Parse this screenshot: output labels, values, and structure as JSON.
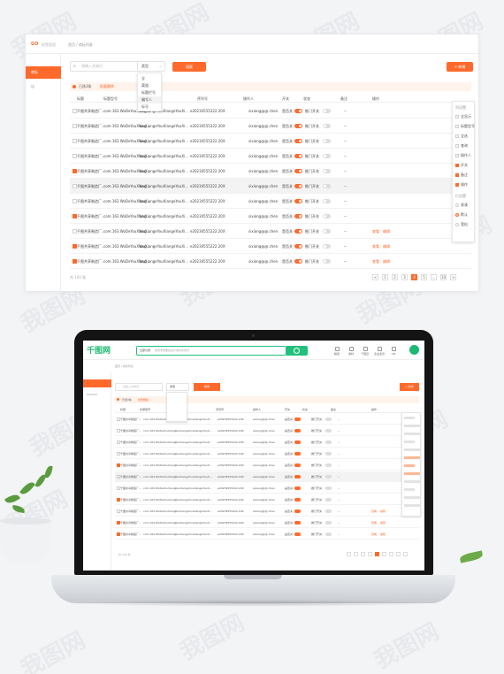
{
  "watermark": "我图网",
  "app": {
    "logo_text": "GO",
    "logo_sub": "配置管理",
    "breadcrumb": "首页 / 商标列表",
    "sidebar": [
      {
        "label": "商标",
        "active": true
      },
      {
        "label": "店",
        "active": false
      }
    ],
    "search": {
      "placeholder": "请输入关键词"
    },
    "select": {
      "value": "类型",
      "options": [
        "全",
        "渠道",
        "标题栏号",
        "编号人",
        "标号"
      ],
      "hovered": 3
    },
    "buttons": {
      "search": "搜索",
      "add": "+ 新增"
    },
    "notice": {
      "text": "已选3条",
      "clear": "批量删除"
    },
    "columns": [
      "标题",
      "标题型号",
      "编号",
      "序列号",
      "操作人",
      "开关",
      "状态",
      "备注",
      "操作"
    ],
    "rows": [
      {
        "checked": false,
        "title": "千图共享制造厂...",
        "model": "com.163.WoDeYouXiang...",
        "code": "YouXiangeYouXiangeYouXi...",
        "serial": "e20234555222.20X",
        "operator": "sixiang@@.chen",
        "switch_label": "是否关",
        "switch_on": true,
        "state": "推门开关",
        "state_on": false,
        "note": "--",
        "actions": []
      },
      {
        "checked": false,
        "title": "千图共享制造厂...",
        "model": "com.163.WoDeYouXiang...",
        "code": "YouXiangeYouXiangeYouXi...",
        "serial": "e20234555222.20X",
        "operator": "sixiang@@.chen",
        "switch_label": "是否关",
        "switch_on": true,
        "state": "推门开关",
        "state_on": false,
        "note": "--",
        "actions": []
      },
      {
        "checked": false,
        "title": "千图共享制造厂...",
        "model": "com.163.WoDeYouXiang...",
        "code": "YouXiangeYouXiangeYouXi...",
        "serial": "e20234555222.20X",
        "operator": "sixiang@@.chen",
        "switch_label": "是否关",
        "switch_on": true,
        "state": "推门开关",
        "state_on": false,
        "note": "--",
        "actions": []
      },
      {
        "checked": false,
        "title": "千图共享制造厂...",
        "model": "com.163.WoDeYouXiang...",
        "code": "YouXiangeYouXiangeYouXi...",
        "serial": "e20234555222.20X",
        "operator": "sixiang@@.chen",
        "switch_label": "是否关",
        "switch_on": true,
        "state": "推门开关",
        "state_on": false,
        "note": "--",
        "actions": []
      },
      {
        "checked": true,
        "title": "千图共享制造厂...",
        "model": "com.163.WoDeYouXiang...",
        "code": "YouXiangeYouXiangeYouXi...",
        "serial": "e20234555222.20X",
        "operator": "sixiang@@.chen",
        "switch_label": "是否关",
        "switch_on": true,
        "state": "推门开关",
        "state_on": false,
        "note": "--",
        "actions": []
      },
      {
        "checked": false,
        "title": "千图共享制造厂...",
        "model": "com.163.WoDeYouXiang...",
        "code": "YouXiangeYouXiangeYouXi...",
        "serial": "e20234555222.20X",
        "operator": "sixiang@@.chen",
        "switch_label": "是否关",
        "switch_on": true,
        "state": "推门开关",
        "state_on": false,
        "note": "--",
        "actions": [],
        "highlight": true
      },
      {
        "checked": false,
        "title": "千图共享制造厂...",
        "model": "com.163.WoDeYouXiang...",
        "code": "YouXiangeYouXiangeYouXi...",
        "serial": "e20234555222.20X",
        "operator": "sixiang@@.chen",
        "switch_label": "是否关",
        "switch_on": true,
        "state": "推门开关",
        "state_on": false,
        "note": "--",
        "actions": []
      },
      {
        "checked": true,
        "title": "千图共享制造厂...",
        "model": "com.163.WoDeYouXiang...",
        "code": "YouXiangeYouXiangeYouXi...",
        "serial": "e20234555222.20X",
        "operator": "sixiang@@.chen",
        "switch_label": "是否关",
        "switch_on": true,
        "state": "推门开关",
        "state_on": false,
        "note": "--",
        "actions": []
      },
      {
        "checked": false,
        "title": "千图共享制造厂...",
        "model": "com.163.WoDeYouXiang...",
        "code": "YouXiangeYouXiangeYouXi...",
        "serial": "e20234555222.20X",
        "operator": "sixiang@@.chen",
        "switch_label": "是否关",
        "switch_on": true,
        "state": "推门开关",
        "state_on": false,
        "note": "--",
        "actions": [
          "查看",
          "编辑"
        ]
      },
      {
        "checked": true,
        "title": "千图共享制造厂...",
        "model": "com.163.WoDeYouXiang...",
        "code": "YouXiangeYouXiangeYouXi...",
        "serial": "e20234555222.20X",
        "operator": "sixiang@@.chen",
        "switch_label": "是否关",
        "switch_on": true,
        "state": "推门开关",
        "state_on": false,
        "note": "--",
        "actions": [
          "查看",
          "编辑"
        ]
      },
      {
        "checked": true,
        "title": "千图共享制造厂...",
        "model": "com.163.WoDeYouXiang...",
        "code": "YouXiangeYouXiangeYouXi...",
        "serial": "e20234555222.20X",
        "operator": "sixiang@@.chen",
        "switch_label": "是否关",
        "switch_on": true,
        "state": "推门开关",
        "state_on": false,
        "note": "--",
        "actions": [
          "查看",
          "编辑"
        ]
      }
    ],
    "filter_panel": {
      "title1": "列设置",
      "items": [
        {
          "label": "全显示",
          "on": false
        },
        {
          "label": "标题型号",
          "on": false
        },
        {
          "label": "全选",
          "on": false
        },
        {
          "label": "查询",
          "on": false
        },
        {
          "label": "操作人",
          "on": false
        },
        {
          "label": "开关",
          "on": true
        },
        {
          "label": "备注",
          "on": true
        },
        {
          "label": "操作",
          "on": true
        }
      ],
      "title2": "行设置",
      "radios": [
        {
          "label": "紧凑",
          "on": false
        },
        {
          "label": "默认",
          "on": true
        },
        {
          "label": "宽松",
          "on": false
        }
      ]
    },
    "footer_text": "共 100 条",
    "pager": [
      "<",
      "1",
      "2",
      "3",
      "4",
      "5",
      "...",
      "10",
      ">"
    ],
    "pager_active": "4"
  },
  "laptop_screen": {
    "logo": "千图网",
    "search_category": "全部分类",
    "search_placeholder": "搜索你想要的设计素材关键词",
    "nav": [
      "精选",
      "素材",
      "千图云",
      "企业会员",
      "VIP"
    ]
  },
  "colors": {
    "accent": "#ff6a2c",
    "brand_green": "#1cb973"
  }
}
